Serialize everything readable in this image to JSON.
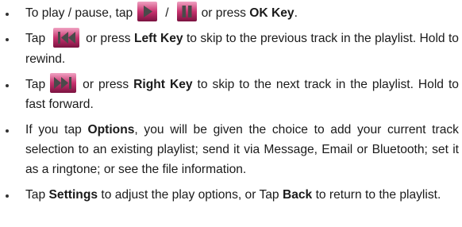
{
  "items": [
    {
      "t1": "To play / pause, tap",
      "sep": "/",
      "t2": "or press",
      "key": "OK Key",
      "t3": "."
    },
    {
      "t1": "Tap",
      "t2": "or press",
      "key": "Left Key",
      "t3": "to skip to the previous track in the playlist. Hold to rewind."
    },
    {
      "t1": "Tap",
      "t2": "or press",
      "key": "Right Key",
      "t3": "to skip to the next track in the playlist. Hold to fast forward."
    },
    {
      "t1": "If you tap",
      "key": "Options",
      "t2": ", you will be given the choice to add your current track selection to an existing playlist; send it via Message, Email or Bluetooth; set it as a ringtone; or see the file information."
    },
    {
      "t1": "Tap",
      "key1": "Settings",
      "t2": "to adjust the play options, or Tap",
      "key2": "Back",
      "t3": "to return to the playlist."
    }
  ],
  "icons": {
    "play": "play-icon",
    "pause": "pause-icon",
    "previous": "previous-track-icon",
    "next": "next-track-icon"
  },
  "colors": {
    "icon_light": "#f0a3c2",
    "icon_mid": "#c8336f",
    "icon_dark": "#7a1240",
    "glyph": "#4a4a4a"
  }
}
